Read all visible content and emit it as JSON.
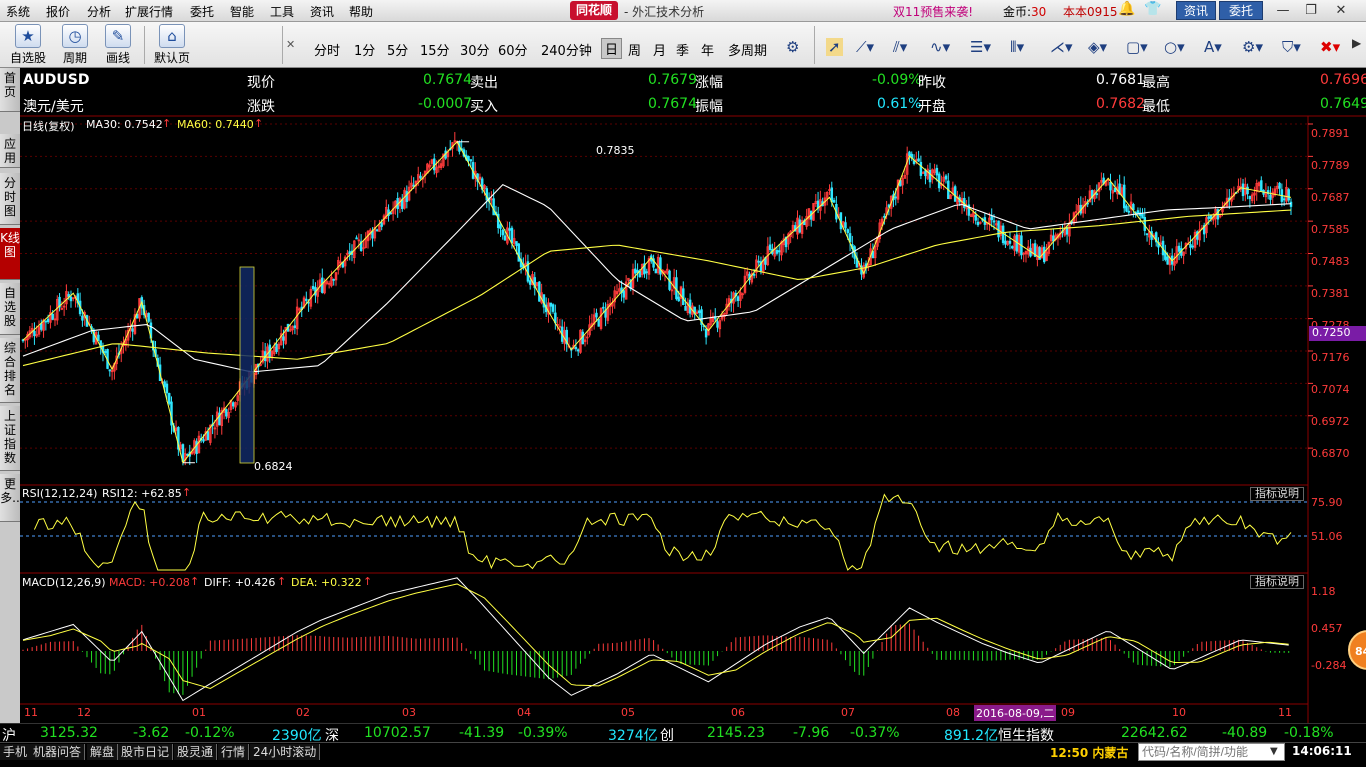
{
  "menu": [
    "系统",
    "报价",
    "分析",
    "扩展行情",
    "委托",
    "智能",
    "工具",
    "资讯",
    "帮助"
  ],
  "app": {
    "logo": "同花顺",
    "title": "- 外汇技术分析",
    "promo": "双11预售来袭!",
    "coins_label": "金币:",
    "coins_value": "30",
    "version": "本本0915",
    "btn_news": "资讯",
    "btn_trade": "委托"
  },
  "window_controls": [
    "—",
    "❐",
    "✕"
  ],
  "toolbar": {
    "big_buttons": [
      {
        "label": "自选股",
        "icon": "star-icon"
      },
      {
        "label": "周期",
        "icon": "clock-icon"
      },
      {
        "label": "画线",
        "icon": "pen-icon"
      },
      {
        "label": "默认页",
        "icon": "home-icon"
      }
    ],
    "periods": [
      "分时",
      "1分",
      "5分",
      "15分",
      "30分",
      "60分",
      "240分钟",
      "日",
      "周",
      "月",
      "季",
      "年",
      "多周期"
    ],
    "active_period": "日"
  },
  "side_tabs": [
    "首页",
    "应用",
    "分时图",
    "K线图",
    "自选股",
    "综合排名",
    "上证指数",
    "更多.."
  ],
  "quote": {
    "symbol": "AUDUSD",
    "name": "澳元/美元",
    "row1": [
      {
        "label": "现价",
        "value": "0.7674"
      },
      {
        "label": "卖出",
        "value": "0.7679"
      },
      {
        "label": "涨幅",
        "value": "-0.09%"
      },
      {
        "label": "昨收",
        "value": "0.7681"
      },
      {
        "label": "最高",
        "value": "0.7696"
      }
    ],
    "row2": [
      {
        "label": "涨跌",
        "value": "-0.0007"
      },
      {
        "label": "买入",
        "value": "0.7674"
      },
      {
        "label": "振幅",
        "value": "0.61%"
      },
      {
        "label": "开盘",
        "value": "0.7682"
      },
      {
        "label": "最低",
        "value": "0.7649"
      }
    ]
  },
  "main_indicator": {
    "name": "日线(复权)",
    "ma30": "MA30: 0.7542",
    "ma60": "MA60: 0.7440",
    "high_label": "0.7835",
    "low_label": "0.6824",
    "current_price_tag": "0.7250"
  },
  "rsi": {
    "label": "RSI(12,12,24)",
    "value": "RSI12: +62.85",
    "help": "指标说明",
    "ticks": [
      "75.90",
      "51.06"
    ]
  },
  "macd": {
    "label": "MACD(12,26,9)",
    "macd": "MACD: +0.208",
    "diff": "DIFF: +0.426",
    "dea": "DEA: +0.322",
    "help": "指标说明",
    "ticks": [
      "1.18",
      "0.457",
      "-0.284"
    ]
  },
  "bubble": "84",
  "chart_data": {
    "type": "candlestick",
    "series": [
      {
        "name": "AUDUSD"
      }
    ],
    "y_ticks": [
      "0.7891",
      "0.7789",
      "0.7687",
      "0.7585",
      "0.7483",
      "0.7381",
      "0.7278",
      "0.7176",
      "0.7074",
      "0.6972",
      "0.6870"
    ],
    "ylim": [
      0.682,
      0.7891
    ],
    "x_months": [
      "11",
      "12",
      "01",
      "02",
      "03",
      "04",
      "05",
      "06",
      "07",
      "08",
      "09",
      "10",
      "11"
    ],
    "cursor_date": "2016-08-09,二",
    "pivots": [
      [
        0,
        0.721
      ],
      [
        22,
        0.7358
      ],
      [
        39,
        0.7118
      ],
      [
        52,
        0.733
      ],
      [
        70,
        0.6824
      ],
      [
        130,
        0.738
      ],
      [
        190,
        0.7835
      ],
      [
        230,
        0.73
      ],
      [
        240,
        0.718
      ],
      [
        275,
        0.747
      ],
      [
        300,
        0.724
      ],
      [
        325,
        0.747
      ],
      [
        353,
        0.766
      ],
      [
        368,
        0.742
      ],
      [
        388,
        0.779
      ],
      [
        420,
        0.759
      ],
      [
        445,
        0.747
      ],
      [
        475,
        0.772
      ],
      [
        503,
        0.746
      ],
      [
        533,
        0.769
      ],
      [
        555,
        0.766
      ]
    ],
    "ma30": [
      [
        0,
        0.716
      ],
      [
        30,
        0.724
      ],
      [
        55,
        0.726
      ],
      [
        75,
        0.715
      ],
      [
        100,
        0.711
      ],
      [
        130,
        0.713
      ],
      [
        160,
        0.733
      ],
      [
        190,
        0.755
      ],
      [
        210,
        0.77
      ],
      [
        230,
        0.763
      ],
      [
        260,
        0.74
      ],
      [
        290,
        0.727
      ],
      [
        320,
        0.73
      ],
      [
        350,
        0.743
      ],
      [
        380,
        0.756
      ],
      [
        410,
        0.764
      ],
      [
        440,
        0.756
      ],
      [
        470,
        0.759
      ],
      [
        500,
        0.762
      ],
      [
        530,
        0.763
      ],
      [
        555,
        0.764
      ]
    ],
    "ma60": [
      [
        0,
        0.713
      ],
      [
        40,
        0.72
      ],
      [
        80,
        0.717
      ],
      [
        120,
        0.715
      ],
      [
        160,
        0.72
      ],
      [
        200,
        0.735
      ],
      [
        230,
        0.749
      ],
      [
        260,
        0.751
      ],
      [
        300,
        0.746
      ],
      [
        340,
        0.74
      ],
      [
        370,
        0.744
      ],
      [
        400,
        0.751
      ],
      [
        430,
        0.755
      ],
      [
        470,
        0.757
      ],
      [
        510,
        0.76
      ],
      [
        555,
        0.762
      ]
    ]
  },
  "ticker": [
    {
      "t": "沪",
      "c": "w"
    },
    {
      "t": "3125.32",
      "c": "g"
    },
    {
      "t": "-3.62",
      "c": "g"
    },
    {
      "t": "-0.12%",
      "c": "g"
    },
    {
      "t": "2390亿",
      "c": "c"
    },
    {
      "t": "深",
      "c": "w"
    },
    {
      "t": "10702.57",
      "c": "g"
    },
    {
      "t": "-41.39",
      "c": "g"
    },
    {
      "t": "-0.39%",
      "c": "g"
    },
    {
      "t": "3274亿",
      "c": "c"
    },
    {
      "t": "创",
      "c": "w"
    },
    {
      "t": "2145.23",
      "c": "g"
    },
    {
      "t": "-7.96",
      "c": "g"
    },
    {
      "t": "-0.37%",
      "c": "g"
    },
    {
      "t": "891.2亿",
      "c": "c"
    },
    {
      "t": "恒生指数",
      "c": "w"
    },
    {
      "t": "22642.62",
      "c": "g"
    },
    {
      "t": "-40.89",
      "c": "g"
    },
    {
      "t": "-0.18%",
      "c": "g"
    }
  ],
  "status": {
    "tabs": [
      "手机",
      "机器问答",
      "解盘",
      "股市日记",
      "股灵通",
      "行情",
      "24小时滚动"
    ],
    "marquee": "12:50 内蒙古",
    "code_placeholder": "代码/名称/简拼/功能",
    "clock": "14:06:11"
  }
}
